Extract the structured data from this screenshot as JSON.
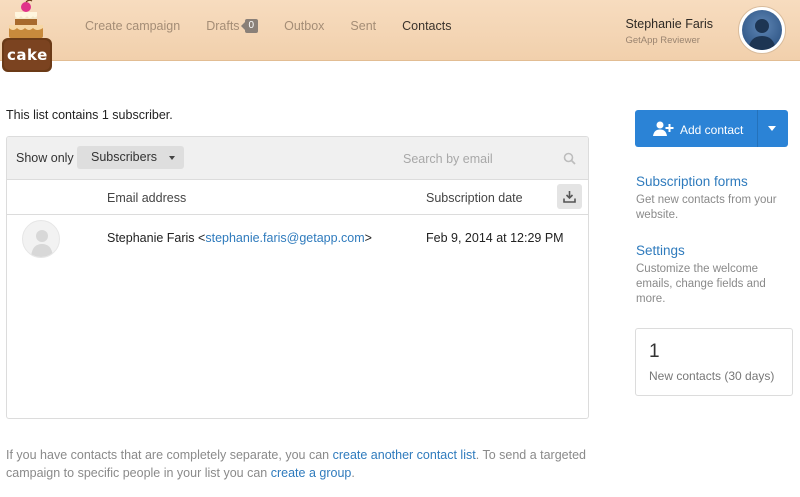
{
  "header": {
    "logo_text": "cake",
    "nav": [
      {
        "label": "Create campaign",
        "active": false
      },
      {
        "label": "Drafts",
        "badge": "0",
        "active": false
      },
      {
        "label": "Outbox",
        "active": false
      },
      {
        "label": "Sent",
        "active": false
      },
      {
        "label": "Contacts",
        "active": true
      }
    ],
    "user": {
      "name": "Stephanie Faris",
      "role": "GetApp Reviewer",
      "avatar_icon": "user-avatar"
    }
  },
  "main": {
    "summary": "This list contains 1 subscriber.",
    "filter": {
      "show_only_label": "Show only",
      "selected": "Subscribers",
      "search_placeholder": "Search by email",
      "search_icon": "search-icon"
    },
    "columns": {
      "email": "Email address",
      "date": "Subscription date"
    },
    "download_icon": "download-icon",
    "rows": [
      {
        "name": "Stephanie Faris",
        "email": "stephanie.faris@getapp.com",
        "date": "Feb 9, 2014 at 12:29 PM",
        "avatar_icon": "default-avatar-icon"
      }
    ],
    "footer": {
      "part1": "If you have contacts that are completely separate, you can ",
      "link1": "create another contact list",
      "part2": ". To send a targeted campaign to specific people in your list you can ",
      "link2": "create a group",
      "part3": "."
    }
  },
  "sidebar": {
    "add_contact_label": "Add contact",
    "subscription_forms": {
      "title": "Subscription forms",
      "desc": "Get new contacts from your website."
    },
    "settings": {
      "title": "Settings",
      "desc": "Customize the welcome emails, change fields and more."
    },
    "stat": {
      "value": "1",
      "label": "New contacts (30 days)"
    }
  },
  "colors": {
    "accent": "#2b83d6",
    "link": "#2f7bbd",
    "header_bg": "#f3d5b4"
  }
}
